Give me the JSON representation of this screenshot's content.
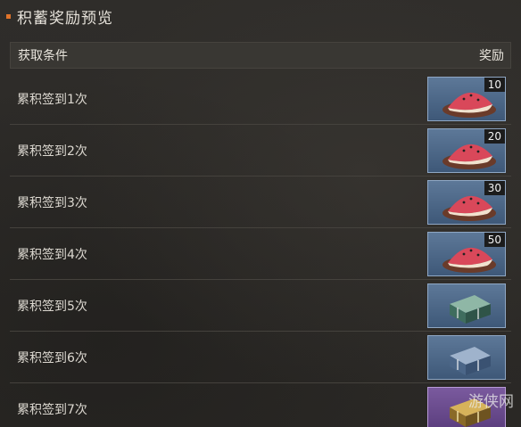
{
  "header": {
    "title": "积蓄奖励预览"
  },
  "columns": {
    "condition": "获取条件",
    "reward": "奖励"
  },
  "rows": [
    {
      "condition": "累积签到1次",
      "reward": {
        "icon": "watermelon-slice-icon",
        "count": "10"
      }
    },
    {
      "condition": "累积签到2次",
      "reward": {
        "icon": "watermelon-slice-icon",
        "count": "20"
      }
    },
    {
      "condition": "累积签到3次",
      "reward": {
        "icon": "watermelon-slice-icon",
        "count": "30"
      }
    },
    {
      "condition": "累积签到4次",
      "reward": {
        "icon": "watermelon-slice-icon",
        "count": "50"
      }
    },
    {
      "condition": "累积签到5次",
      "reward": {
        "icon": "green-supply-crate-icon"
      }
    },
    {
      "condition": "累积签到6次",
      "reward": {
        "icon": "blue-supply-crate-icon"
      }
    },
    {
      "condition": "累积签到7次",
      "reward": {
        "icon": "gold-supply-crate-icon"
      }
    }
  ],
  "watermark": "游侠网",
  "colors": {
    "accent": "#e0732a",
    "rare_frame": "#4f6b8c",
    "epic_frame": "#6a4b8e"
  }
}
